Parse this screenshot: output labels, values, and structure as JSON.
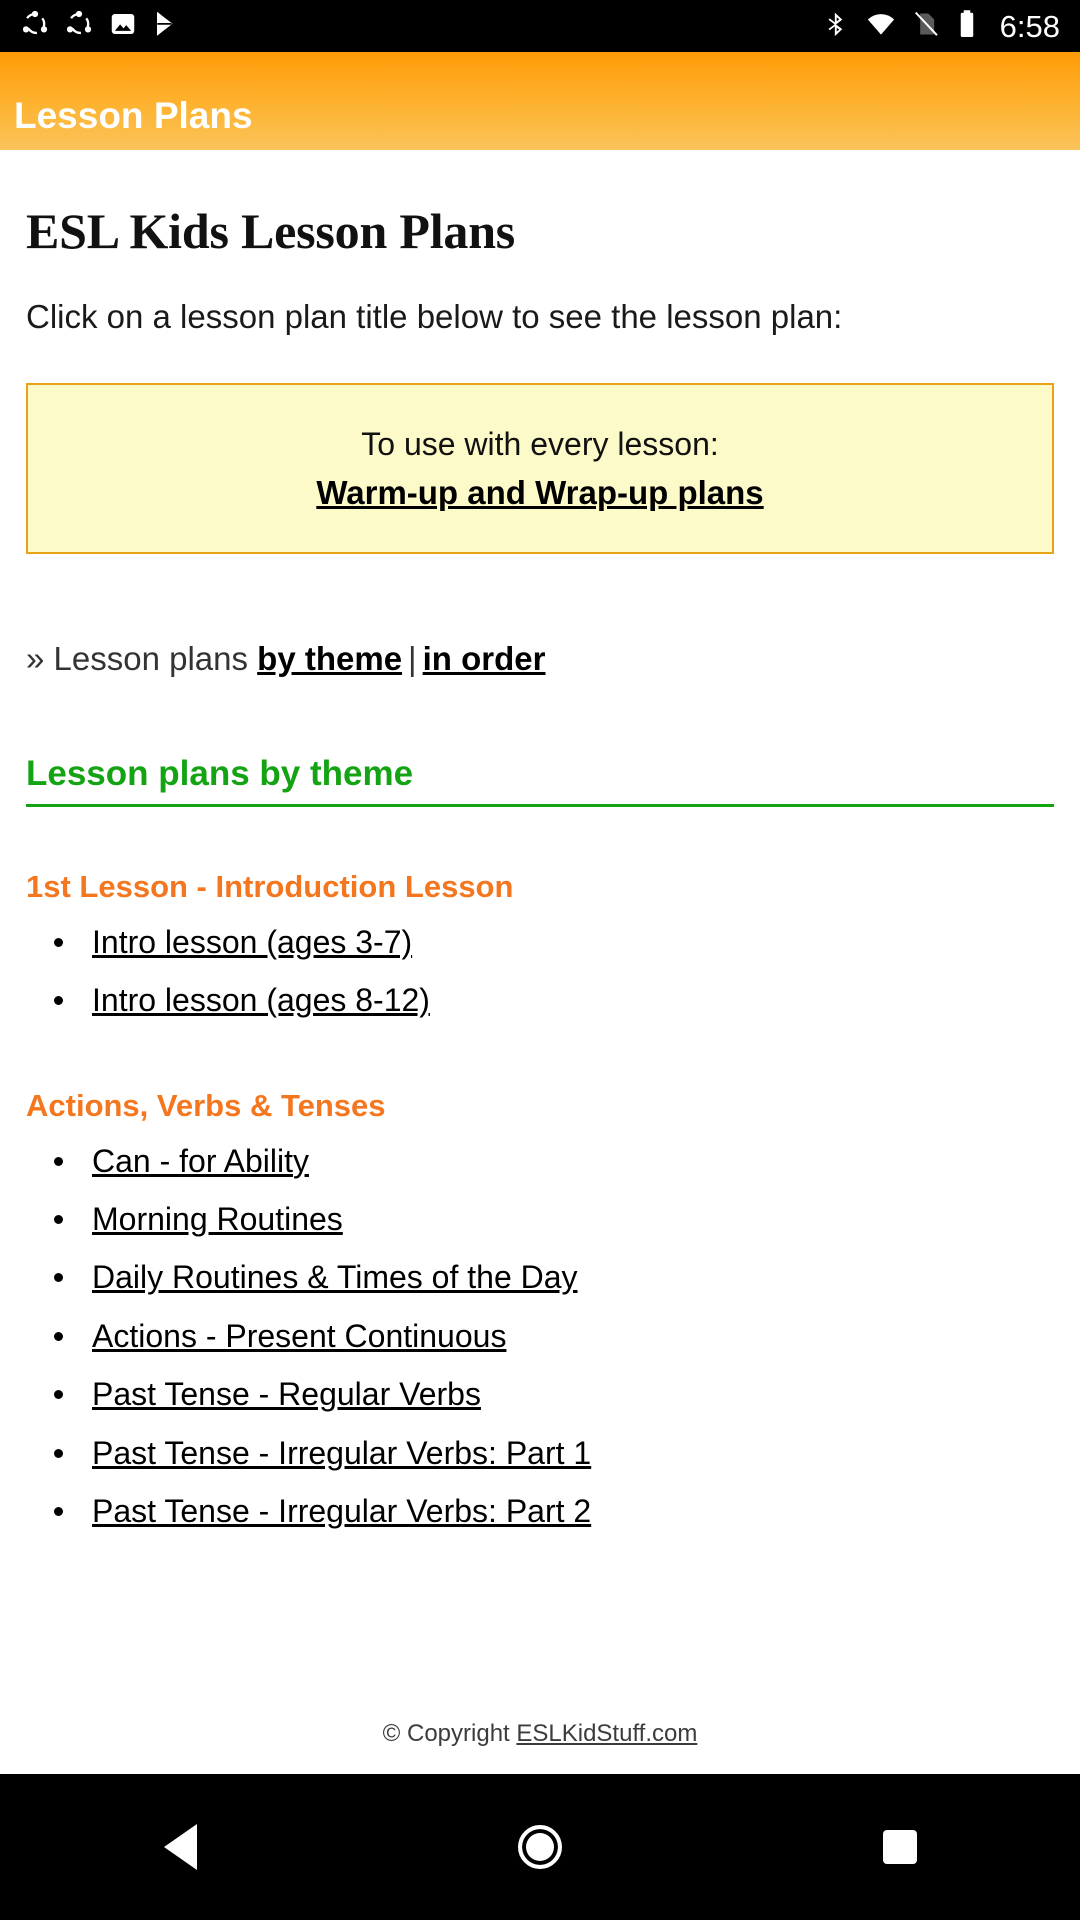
{
  "statusbar": {
    "time": "6:58",
    "left_icons": [
      "sync-icon",
      "sync-icon",
      "image-icon",
      "play-store-icon"
    ],
    "right_icons": [
      "bluetooth-icon",
      "wifi-icon",
      "no-sim-icon",
      "battery-icon"
    ]
  },
  "appbar": {
    "title": "Lesson Plans",
    "gradient_top": "#FF9B06",
    "gradient_bottom": "#FBC35B"
  },
  "page": {
    "title": "ESL Kids Lesson Plans",
    "intro": "Click on a lesson plan title below to see the lesson plan:",
    "callout": {
      "line1": "To use with every lesson:",
      "link": "Warm-up and Wrap-up plans",
      "background": "#FCFAC8",
      "border": "#E8A317"
    },
    "nav": {
      "prefix": "» Lesson plans",
      "link1": "by theme",
      "separator": "|",
      "link2": "in order"
    },
    "section": {
      "heading": "Lesson plans by theme",
      "color": "#13A313"
    },
    "themes": [
      {
        "heading": "1st Lesson - Introduction Lesson",
        "color": "#F4761F",
        "links": [
          "Intro lesson (ages 3-7)",
          "Intro lesson (ages 8-12)"
        ]
      },
      {
        "heading": "Actions, Verbs & Tenses",
        "color": "#F4761F",
        "links": [
          "Can - for Ability",
          "Morning Routines",
          "Daily Routines & Times of the Day",
          "Actions - Present Continuous",
          "Past Tense - Regular Verbs",
          "Past Tense - Irregular Verbs: Part 1",
          "Past Tense - Irregular Verbs: Part 2"
        ]
      }
    ],
    "footer": {
      "copyright": "© Copyright ",
      "site": "ESLKidStuff.com"
    }
  },
  "navbar": {
    "back": "back-button",
    "home": "home-button",
    "recents": "recents-button"
  }
}
